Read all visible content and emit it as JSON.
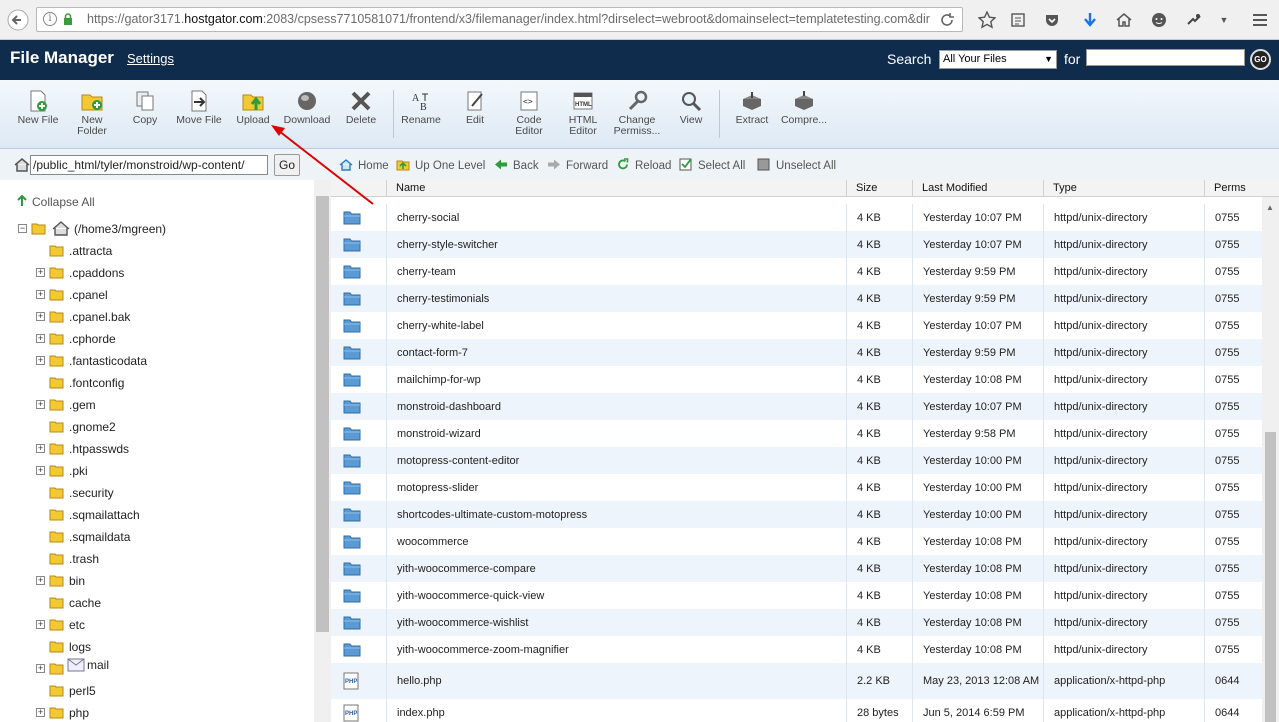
{
  "browser": {
    "url_prefix": "https://gator3171.",
    "url_host": "hostgator.com",
    "url_rest": ":2083/cpsess7710581071/frontend/x3/filemanager/index.html?dirselect=webroot&domainselect=templatetesting.com&dir"
  },
  "header": {
    "title": "File Manager",
    "settings": "Settings",
    "search_label": "Search",
    "search_scope": "All Your Files",
    "for_label": "for",
    "search_value": "",
    "go_label": "GO"
  },
  "toolbar": {
    "new_file": "New File",
    "new_folder": "New Folder",
    "copy": "Copy",
    "move_file": "Move File",
    "upload": "Upload",
    "download": "Download",
    "delete": "Delete",
    "rename": "Rename",
    "edit": "Edit",
    "code_editor": "Code Editor",
    "html_editor": "HTML Editor",
    "change_permissions": "Change Permiss...",
    "view": "View",
    "extract": "Extract",
    "compress": "Compre..."
  },
  "path": {
    "value": "/public_html/tyler/monstroid/wp-content/",
    "go": "Go"
  },
  "nav": {
    "home": "Home",
    "up_one_level": "Up One Level",
    "back": "Back",
    "forward": "Forward",
    "reload": "Reload",
    "select_all": "Select All",
    "unselect_all": "Unselect All"
  },
  "tree": {
    "collapse_all": "Collapse All",
    "root": "(/home3/mgreen)",
    "items": [
      {
        "name": ".attracta",
        "expandable": false
      },
      {
        "name": ".cpaddons",
        "expandable": true
      },
      {
        "name": ".cpanel",
        "expandable": true
      },
      {
        "name": ".cpanel.bak",
        "expandable": true
      },
      {
        "name": ".cphorde",
        "expandable": true
      },
      {
        "name": ".fantasticodata",
        "expandable": true
      },
      {
        "name": ".fontconfig",
        "expandable": false
      },
      {
        "name": ".gem",
        "expandable": true
      },
      {
        "name": ".gnome2",
        "expandable": false
      },
      {
        "name": ".htpasswds",
        "expandable": true
      },
      {
        "name": ".pki",
        "expandable": true
      },
      {
        "name": ".security",
        "expandable": false
      },
      {
        "name": ".sqmailattach",
        "expandable": false
      },
      {
        "name": ".sqmaildata",
        "expandable": false
      },
      {
        "name": ".trash",
        "expandable": false
      },
      {
        "name": "bin",
        "expandable": true
      },
      {
        "name": "cache",
        "expandable": false
      },
      {
        "name": "etc",
        "expandable": true
      },
      {
        "name": "logs",
        "expandable": false
      },
      {
        "name": "mail",
        "expandable": true,
        "icon": "mail"
      },
      {
        "name": "perl5",
        "expandable": false
      },
      {
        "name": "php",
        "expandable": true
      }
    ]
  },
  "grid": {
    "headers": {
      "name": "Name",
      "size": "Size",
      "modified": "Last Modified",
      "type": "Type",
      "perms": "Perms"
    },
    "rows": [
      {
        "name": "cherry-social",
        "size": "4 KB",
        "modified": "Yesterday 10:07 PM",
        "type": "httpd/unix-directory",
        "perms": "0755",
        "kind": "folder"
      },
      {
        "name": "cherry-style-switcher",
        "size": "4 KB",
        "modified": "Yesterday 10:07 PM",
        "type": "httpd/unix-directory",
        "perms": "0755",
        "kind": "folder"
      },
      {
        "name": "cherry-team",
        "size": "4 KB",
        "modified": "Yesterday 9:59 PM",
        "type": "httpd/unix-directory",
        "perms": "0755",
        "kind": "folder"
      },
      {
        "name": "cherry-testimonials",
        "size": "4 KB",
        "modified": "Yesterday 9:59 PM",
        "type": "httpd/unix-directory",
        "perms": "0755",
        "kind": "folder"
      },
      {
        "name": "cherry-white-label",
        "size": "4 KB",
        "modified": "Yesterday 10:07 PM",
        "type": "httpd/unix-directory",
        "perms": "0755",
        "kind": "folder"
      },
      {
        "name": "contact-form-7",
        "size": "4 KB",
        "modified": "Yesterday 9:59 PM",
        "type": "httpd/unix-directory",
        "perms": "0755",
        "kind": "folder"
      },
      {
        "name": "mailchimp-for-wp",
        "size": "4 KB",
        "modified": "Yesterday 10:08 PM",
        "type": "httpd/unix-directory",
        "perms": "0755",
        "kind": "folder"
      },
      {
        "name": "monstroid-dashboard",
        "size": "4 KB",
        "modified": "Yesterday 10:07 PM",
        "type": "httpd/unix-directory",
        "perms": "0755",
        "kind": "folder"
      },
      {
        "name": "monstroid-wizard",
        "size": "4 KB",
        "modified": "Yesterday 9:58 PM",
        "type": "httpd/unix-directory",
        "perms": "0755",
        "kind": "folder"
      },
      {
        "name": "motopress-content-editor",
        "size": "4 KB",
        "modified": "Yesterday 10:00 PM",
        "type": "httpd/unix-directory",
        "perms": "0755",
        "kind": "folder"
      },
      {
        "name": "motopress-slider",
        "size": "4 KB",
        "modified": "Yesterday 10:00 PM",
        "type": "httpd/unix-directory",
        "perms": "0755",
        "kind": "folder"
      },
      {
        "name": "shortcodes-ultimate-custom-motopress",
        "size": "4 KB",
        "modified": "Yesterday 10:00 PM",
        "type": "httpd/unix-directory",
        "perms": "0755",
        "kind": "folder"
      },
      {
        "name": "woocommerce",
        "size": "4 KB",
        "modified": "Yesterday 10:08 PM",
        "type": "httpd/unix-directory",
        "perms": "0755",
        "kind": "folder"
      },
      {
        "name": "yith-woocommerce-compare",
        "size": "4 KB",
        "modified": "Yesterday 10:08 PM",
        "type": "httpd/unix-directory",
        "perms": "0755",
        "kind": "folder"
      },
      {
        "name": "yith-woocommerce-quick-view",
        "size": "4 KB",
        "modified": "Yesterday 10:08 PM",
        "type": "httpd/unix-directory",
        "perms": "0755",
        "kind": "folder"
      },
      {
        "name": "yith-woocommerce-wishlist",
        "size": "4 KB",
        "modified": "Yesterday 10:08 PM",
        "type": "httpd/unix-directory",
        "perms": "0755",
        "kind": "folder"
      },
      {
        "name": "yith-woocommerce-zoom-magnifier",
        "size": "4 KB",
        "modified": "Yesterday 10:08 PM",
        "type": "httpd/unix-directory",
        "perms": "0755",
        "kind": "folder"
      },
      {
        "name": "hello.php",
        "size": "2.2 KB",
        "modified": "May 23, 2013 12:08 AM",
        "type": "application/x-httpd-php",
        "perms": "0644",
        "kind": "php"
      },
      {
        "name": "index.php",
        "size": "28 bytes",
        "modified": "Jun 5, 2014 6:59 PM",
        "type": "application/x-httpd-php",
        "perms": "0644",
        "kind": "php"
      }
    ]
  },
  "colors": {
    "header_bg": "#0f2c4d",
    "annotation_arrow": "#e00000",
    "row_alt": "#eef4fb"
  }
}
